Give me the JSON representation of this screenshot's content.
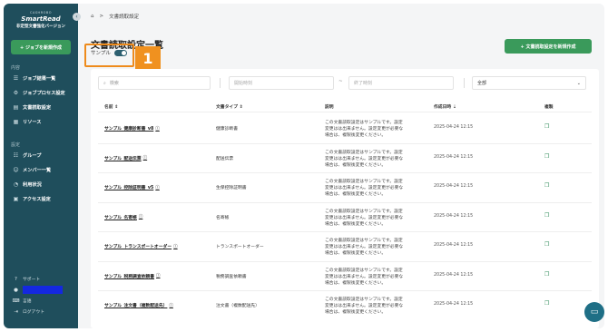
{
  "sidebar": {
    "brand_small": "CASHROBO",
    "brand_main": "SmartRead",
    "brand_sub": "非定型文書強化バージョン",
    "collapse_icon": "‹",
    "new_job": "+ ジョブを新規作成",
    "section_content": "内容",
    "items_content": [
      {
        "label": "ジョブ結果一覧",
        "icon": "list-icon"
      },
      {
        "label": "ジョブプロセス設定",
        "icon": "process-icon"
      },
      {
        "label": "文書読取設定",
        "icon": "document-icon"
      },
      {
        "label": "リソース",
        "icon": "resource-icon"
      }
    ],
    "section_settings": "設定",
    "items_settings": [
      {
        "label": "グループ",
        "icon": "group-icon"
      },
      {
        "label": "メンバー一覧",
        "icon": "members-icon"
      },
      {
        "label": "利用状況",
        "icon": "usage-icon"
      },
      {
        "label": "アクセス設定",
        "icon": "access-icon"
      }
    ],
    "footer": {
      "support": "サポート",
      "language": "言語",
      "logout": "ログアウト"
    }
  },
  "breadcrumb": {
    "home_icon": "home-icon",
    "separator": ">",
    "current": "文書読取設定"
  },
  "page_title": "文書読取設定一覧",
  "sample_toggle": {
    "label": "サンプル",
    "enabled": true
  },
  "step_badge": "1",
  "new_setting_button": "+ 文書読取設定を新規作成",
  "filters": {
    "search_placeholder": "検索",
    "start_date_placeholder": "開始時刻",
    "tilde": "~",
    "end_date_placeholder": "終了時刻",
    "select_value": "全部"
  },
  "table": {
    "headers": {
      "name": "名前 ⇕",
      "doc_type": "文書タイプ ⇕",
      "description": "説明",
      "created": "作成日時 ⇣",
      "copy": "複製"
    },
    "rows": [
      {
        "name": "サンプル_健康診断書_v8",
        "type": "健康診断書",
        "desc": "この文書読取設定はサンプルです。設定変更はは出来ません。設定変更が必要な場合は、複製後変更ください。",
        "date": "2025-04-24 12:15"
      },
      {
        "name": "サンプル_配送伝票",
        "type": "配送伝票",
        "desc": "この文書読取設定はサンプルです。設定変更はは出来ません。設定変更が必要な場合は、複製後変更ください。",
        "date": "2025-04-24 12:15"
      },
      {
        "name": "サンプル_控除証明書_v5",
        "type": "生保控除証明書",
        "desc": "この文書読取設定はサンプルです。設定変更はは出来ません。設定変更が必要な場合は、複製後変更ください。",
        "date": "2025-04-24 12:15"
      },
      {
        "name": "サンプル_名寄帳",
        "type": "名寄帳",
        "desc": "この文書読取設定はサンプルです。設定変更はは出来ません。設定変更が必要な場合は、複製後変更ください。",
        "date": "2025-04-24 12:15"
      },
      {
        "name": "サンプル_トランスポートオーダー",
        "type": "トランスポートオーダー",
        "desc": "この文書読取設定はサンプルです。設定変更はは出来ません。設定変更が必要な場合は、複製後変更ください。",
        "date": "2025-04-24 12:15"
      },
      {
        "name": "サンプル_税務調査依頼書",
        "type": "税務調査依頼書",
        "desc": "この文書読取設定はサンプルです。設定変更はは出来ません。設定変更が必要な場合は、複製後変更ください。",
        "date": "2025-04-24 12:15"
      },
      {
        "name": "サンプル_注文書（複数配送先）",
        "type": "注文書（複数配送先）",
        "desc": "この文書読取設定はサンプルです。設定変更はは出来ません。設定変更が必要な場合は、複製後変更ください。",
        "date": "2025-04-24 12:15"
      }
    ]
  },
  "colors": {
    "sidebar": "#1f4e5c",
    "accent_green": "#3a9a5b",
    "highlight_orange": "#f0911f"
  }
}
